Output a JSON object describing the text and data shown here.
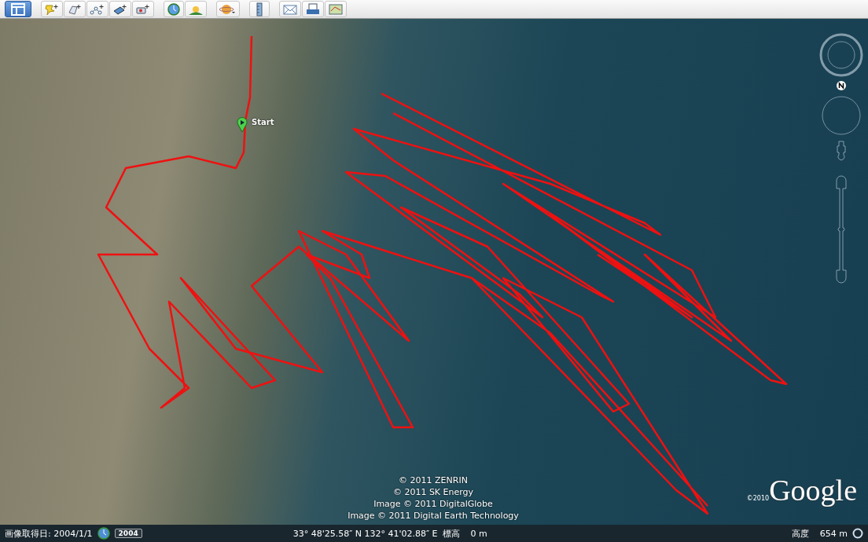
{
  "map": {
    "marker_label": "Start",
    "attribution": [
      "© 2011 ZENRIN",
      "© 2011 SK Energy",
      "Image © 2011 DigitalGlobe",
      "Image © 2011 Digital Earth Technology"
    ],
    "logo_year": "©2010",
    "logo": "Google"
  },
  "status_bar": {
    "imagery_date": "画像取得日: 2004/1/1",
    "timeline_year": "2004",
    "coordinates": "33° 48'25.58″ N 132° 41'02.88″ E",
    "elevation_label": "標高",
    "elevation": "0 m",
    "altitude_label": "高度",
    "altitude": "654 m"
  }
}
